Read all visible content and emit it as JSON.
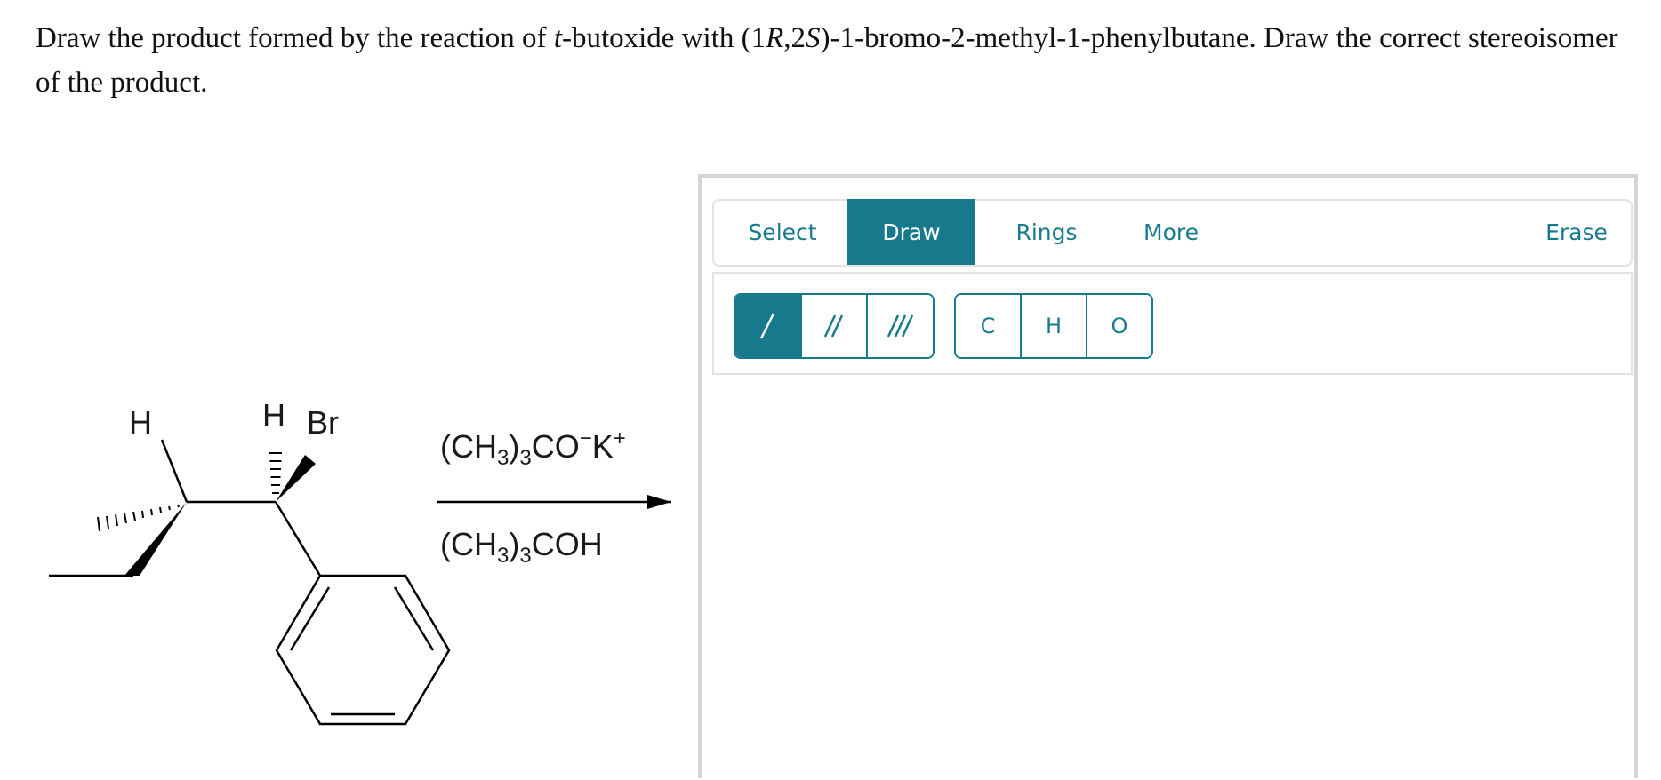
{
  "question": {
    "part1": "Draw the product formed by the reaction of ",
    "italic_t": "t",
    "part2": "-butoxide with (1",
    "italic_R": "R",
    "part3": ",2",
    "italic_S": "S",
    "part4": ")-1-bromo-2-methyl-1-phenylbutane. Draw the correct stereoisomer of the product."
  },
  "scheme": {
    "reagent_top": {
      "a": "(CH",
      "a_sub": "3",
      "b": ")",
      "b_sub": "3",
      "c": "CO",
      "c_sup": "−",
      "d": "K",
      "d_sup": "+"
    },
    "reagent_bottom": {
      "a": "(CH",
      "a_sub": "3",
      "b": ")",
      "b_sub": "3",
      "c": "COH"
    },
    "atoms": {
      "h_left": "H",
      "h_right": "H",
      "br": "Br"
    }
  },
  "editor": {
    "tabs": {
      "select": "Select",
      "draw": "Draw",
      "rings": "Rings",
      "more": "More",
      "erase": "Erase"
    },
    "active_tab": "Draw",
    "bond_tools": [
      "single-bond",
      "double-bond",
      "triple-bond"
    ],
    "active_bond_tool": "single-bond",
    "atom_tools": [
      "C",
      "H",
      "O"
    ]
  },
  "colors": {
    "accent": "#177a8c",
    "border": "#d4d4d4",
    "panel_border": "#e3e3e3",
    "text": "#111111"
  }
}
